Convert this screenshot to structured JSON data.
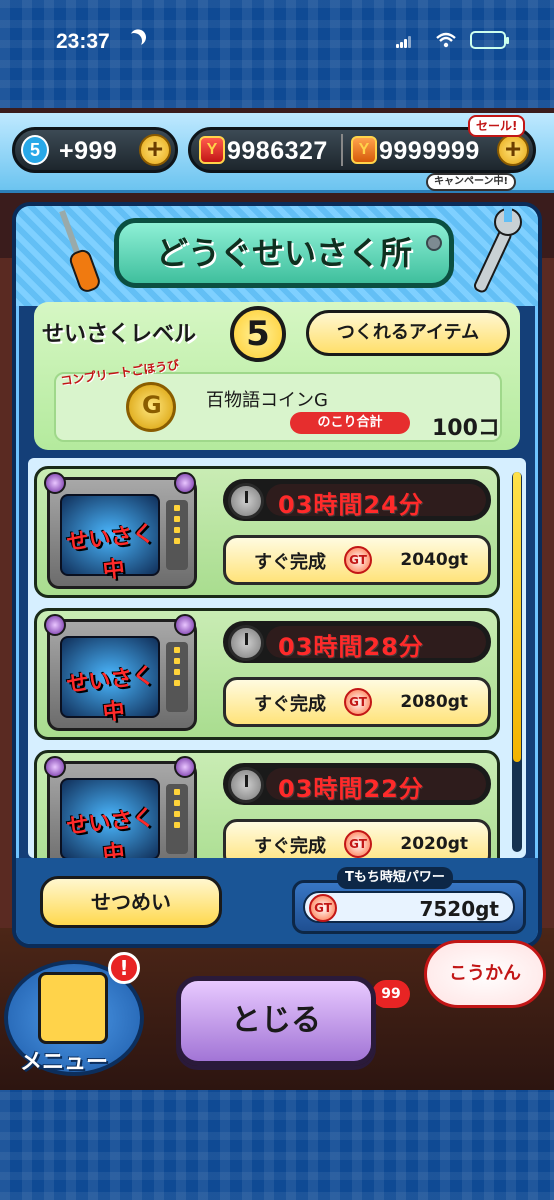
{
  "status": {
    "time": "23:37"
  },
  "currency": {
    "spirit_level": "5",
    "spirit_count": "+999",
    "yen": "9986327",
    "points": "9999999",
    "sale_tag": "セール!",
    "campaign_tag": "キャンペーン中!"
  },
  "workshop": {
    "title": "どうぐせいさく所",
    "level_label": "せいさくレベル",
    "level": "5",
    "makeable_button": "つくれるアイテム",
    "reward_tag": "コンプリートごほうび",
    "reward_name": "百物語コインG",
    "remaining_label": "のこり合計",
    "remaining_count": "100コ",
    "crafting_badge": "せいさく中",
    "instant_label": "すぐ完成",
    "gt_icon": "GT",
    "jobs": [
      {
        "time": "03時間24分",
        "cost": "2040gt"
      },
      {
        "time": "03時間28分",
        "cost": "2080gt"
      },
      {
        "time": "03時間22分",
        "cost": "2020gt"
      }
    ],
    "explain_button": "せつめい",
    "power_label": "Tもち時短パワー",
    "power_value": "7520gt"
  },
  "bottom": {
    "menu_label": "メニュー",
    "menu_notice": "!",
    "close_button": "とじる",
    "exchange_button": "こうかん",
    "bg_badge": "99"
  },
  "colors": {
    "accent_blue": "#0f4a94",
    "timer_red": "#ff2a2a",
    "button_yellow": "#ffe37a",
    "close_purple": "#a275d6"
  },
  "icons": [
    "moon-icon",
    "signal-icon",
    "wifi-icon",
    "battery-icon",
    "plus-icon",
    "y-coin-icon",
    "screwdriver-icon",
    "wrench-icon",
    "medal-icon",
    "clock-icon",
    "gt-icon"
  ]
}
